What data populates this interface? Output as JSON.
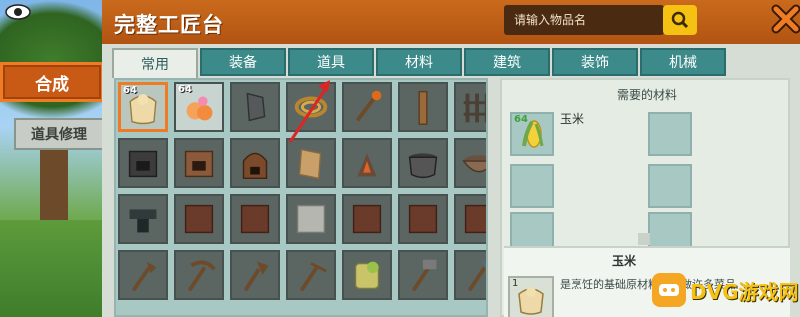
{
  "side": {
    "craft_label": "合成",
    "repair_label": "道具修理"
  },
  "window": {
    "title": "完整工匠台",
    "search_placeholder": "请输入物品名",
    "search_icon": "search-icon",
    "close_icon": "close-icon"
  },
  "tabs": [
    "常用",
    "装备",
    "道具",
    "材料",
    "建筑",
    "装饰",
    "机械"
  ],
  "active_tab": "常用",
  "grid": {
    "items": [
      {
        "icon": "flour-sack-icon",
        "count": "64",
        "selected": true
      },
      {
        "icon": "peach-icon",
        "count": "64",
        "highlight": true
      },
      {
        "icon": "stone-icon",
        "count": ""
      },
      {
        "icon": "rope-icon",
        "count": ""
      },
      {
        "icon": "torch-icon",
        "count": ""
      },
      {
        "icon": "stick-icon",
        "count": ""
      },
      {
        "icon": "fence-icon",
        "count": ""
      },
      {
        "icon": "furnace-icon",
        "count": ""
      },
      {
        "icon": "oven-icon",
        "count": ""
      },
      {
        "icon": "kiln-icon",
        "count": ""
      },
      {
        "icon": "paper-icon",
        "count": ""
      },
      {
        "icon": "campfire-icon",
        "count": ""
      },
      {
        "icon": "cooking-pot-icon",
        "count": ""
      },
      {
        "icon": "bowl-icon",
        "count": ""
      },
      {
        "icon": "anvil-icon",
        "count": ""
      },
      {
        "icon": "brown-block-icon",
        "count": ""
      },
      {
        "icon": "brown-block-icon",
        "count": ""
      },
      {
        "icon": "gray-block-icon",
        "count": ""
      },
      {
        "icon": "brown-block-icon",
        "count": ""
      },
      {
        "icon": "brown-block-icon",
        "count": ""
      },
      {
        "icon": "brown-block-icon",
        "count": ""
      },
      {
        "icon": "axe-icon",
        "count": ""
      },
      {
        "icon": "pickaxe-icon",
        "count": ""
      },
      {
        "icon": "shovel-icon",
        "count": ""
      },
      {
        "icon": "rake-icon",
        "count": ""
      },
      {
        "icon": "seed-bag-icon",
        "count": ""
      },
      {
        "icon": "hammer-icon",
        "count": ""
      },
      {
        "icon": "hatchet-icon",
        "count": ""
      }
    ]
  },
  "requirements": {
    "title": "需要的材料",
    "first_item_name": "玉米",
    "first_item_count": "64",
    "first_item_icon": "corn-icon"
  },
  "description": {
    "title": "玉米",
    "count": "1",
    "icon": "flour-sack-icon",
    "text": "是烹饪的基础原材料，可做许多菜品"
  },
  "watermark": {
    "text": "DVG游戏网"
  },
  "colors": {
    "accent": "#c95a16",
    "tab_teal": "#3c8a8a",
    "highlight_orange": "#ef7b27",
    "search_yellow": "#f5c213",
    "annotation_red": "#e02424"
  }
}
